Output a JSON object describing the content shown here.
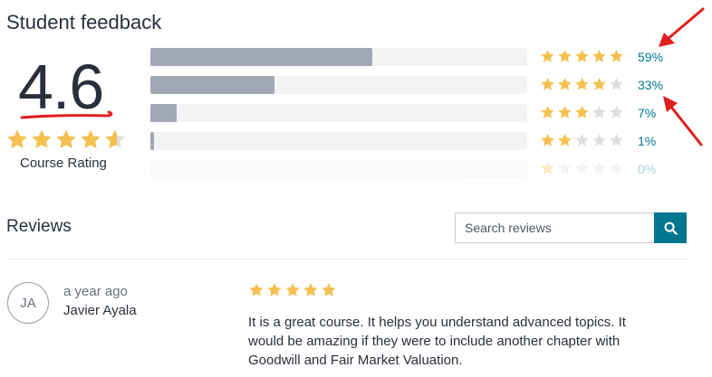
{
  "header": {
    "title": "Student feedback"
  },
  "summary": {
    "rating": "4.6",
    "rating_value": 4.6,
    "label": "Course Rating"
  },
  "distribution": [
    {
      "stars": 5,
      "percent_label": "59%",
      "percent": 59
    },
    {
      "stars": 4,
      "percent_label": "33%",
      "percent": 33
    },
    {
      "stars": 3,
      "percent_label": "7%",
      "percent": 7
    },
    {
      "stars": 2,
      "percent_label": "1%",
      "percent": 1
    },
    {
      "stars": 1,
      "percent_label": "0%",
      "percent": 0
    }
  ],
  "reviews_section": {
    "title": "Reviews",
    "search_placeholder": "Search reviews",
    "search_icon": "search-icon"
  },
  "reviews": [
    {
      "initials": "JA",
      "time": "a year ago",
      "name": "Javier Ayala",
      "stars": 5,
      "text": "It is a great course. It helps you understand advanced topics. It would be amazing if they were to include another chapter with Goodwill and Fair Market Valuation."
    }
  ],
  "colors": {
    "star_filled": "#f4c150",
    "star_empty": "#dedfe0",
    "bar_fill": "#a1a7b3",
    "bar_track": "#f2f3f5",
    "link": "#007791",
    "annotation": "#e02020"
  }
}
